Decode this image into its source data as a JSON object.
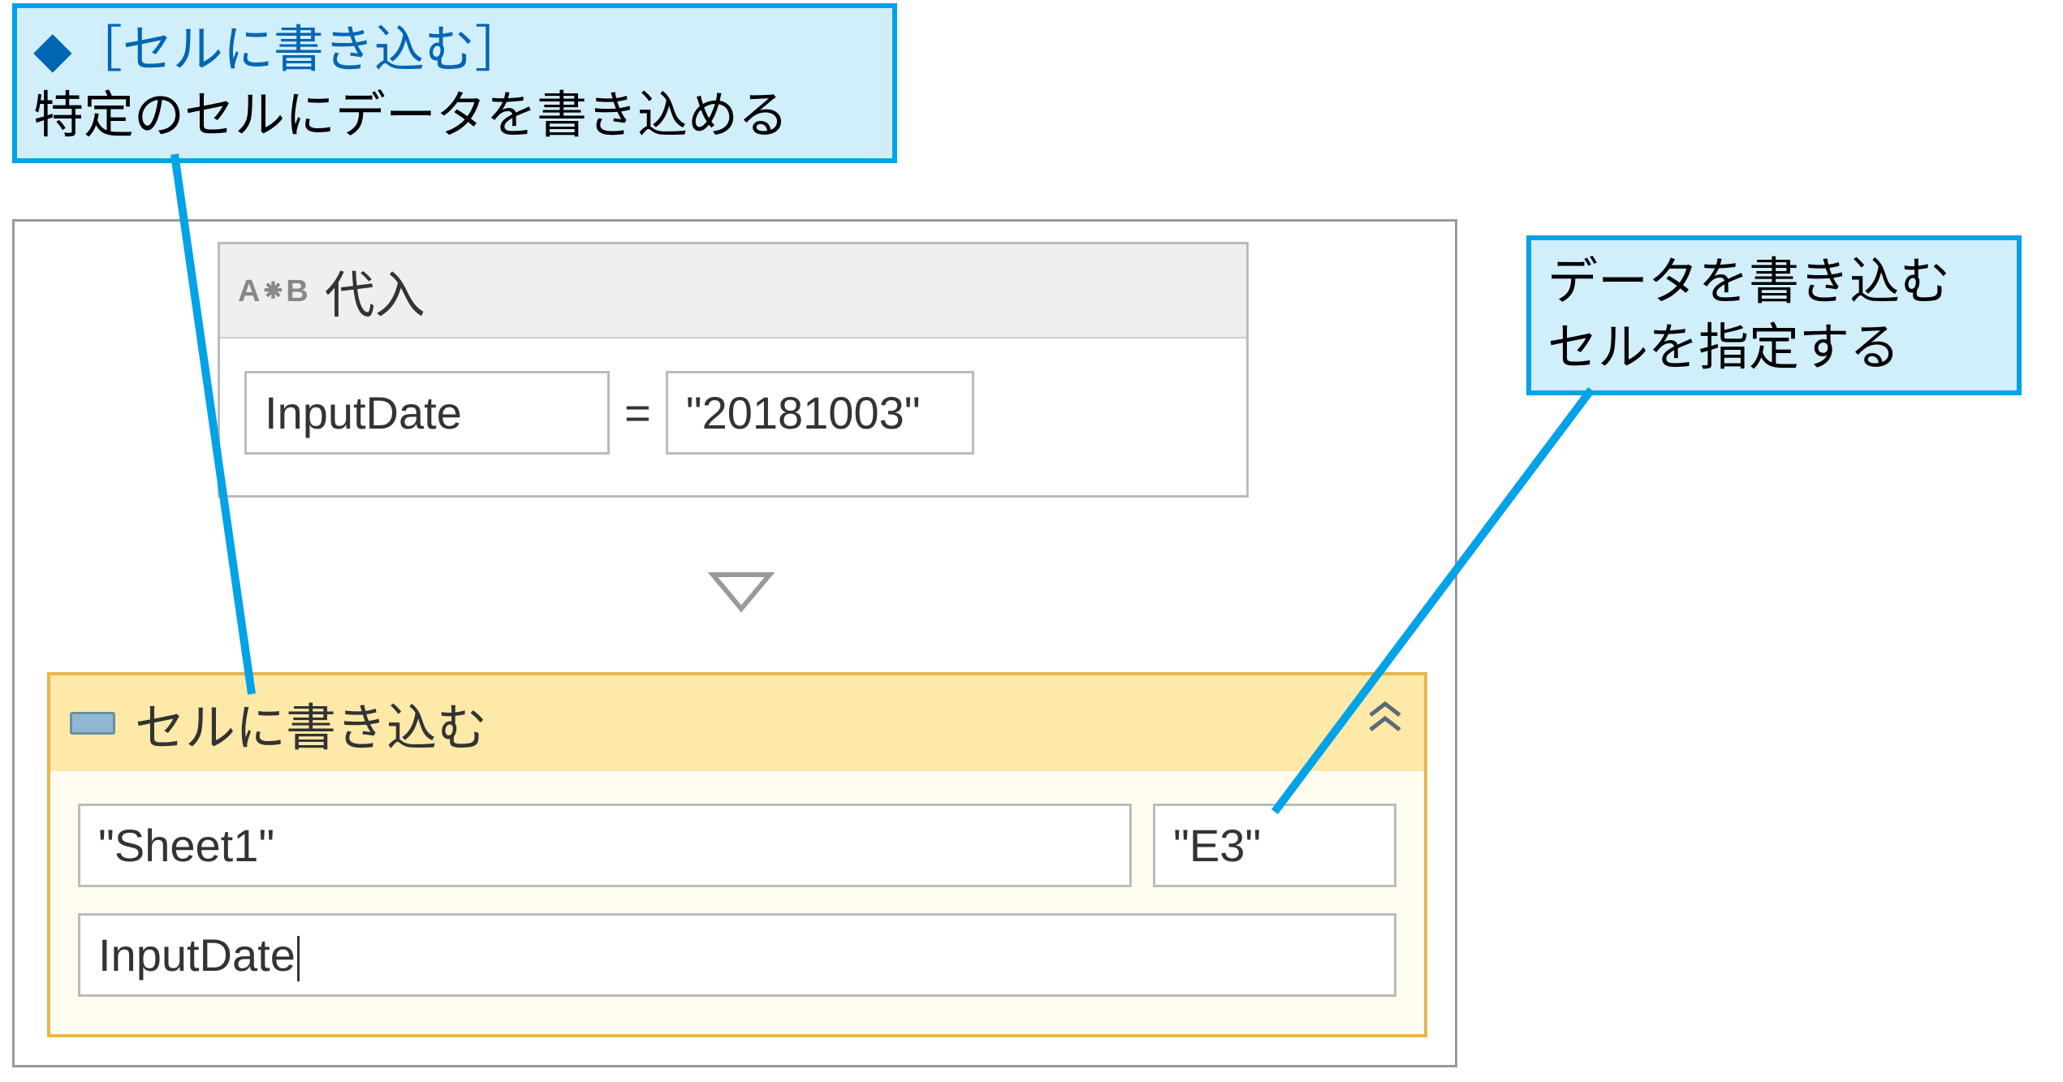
{
  "callouts": {
    "top": {
      "heading_marker": "◆",
      "heading_text": "［セルに書き込む］",
      "body": "特定のセルにデータを書き込める"
    },
    "right": {
      "line1": "データを書き込む",
      "line2": "セルを指定する"
    }
  },
  "activities": {
    "assign": {
      "icon_label": "A⁕B",
      "title": "代入",
      "left_value": "InputDate",
      "equals": "=",
      "right_value": "\"20181003\""
    },
    "writeCell": {
      "title": "セルに書き込む",
      "sheet": "\"Sheet1\"",
      "cell": "\"E3\"",
      "value": "InputDate"
    }
  }
}
